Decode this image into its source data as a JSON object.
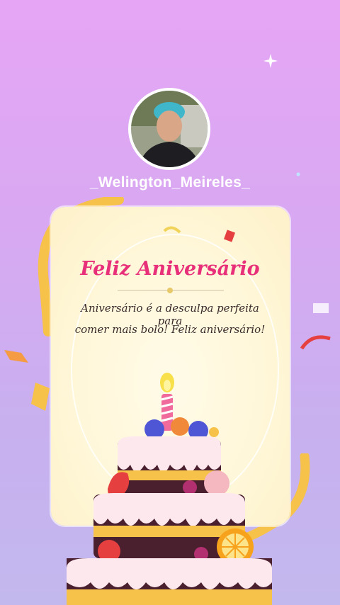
{
  "profile": {
    "username": "_Welington_Meireles_"
  },
  "card": {
    "title": "Feliz Aniversário",
    "message_line1": "Aniversário é a desculpa perfeita para",
    "message_line2": "comer mais bolo! Feliz aniversário!"
  },
  "colors": {
    "background_top": "#e6a6f5",
    "background_bottom": "#c3b8ee",
    "title": "#e8307a",
    "card": "#fff7d9"
  },
  "icons": [
    "sparkle-icon",
    "birthday-cake-illustration",
    "avatar-photo"
  ]
}
